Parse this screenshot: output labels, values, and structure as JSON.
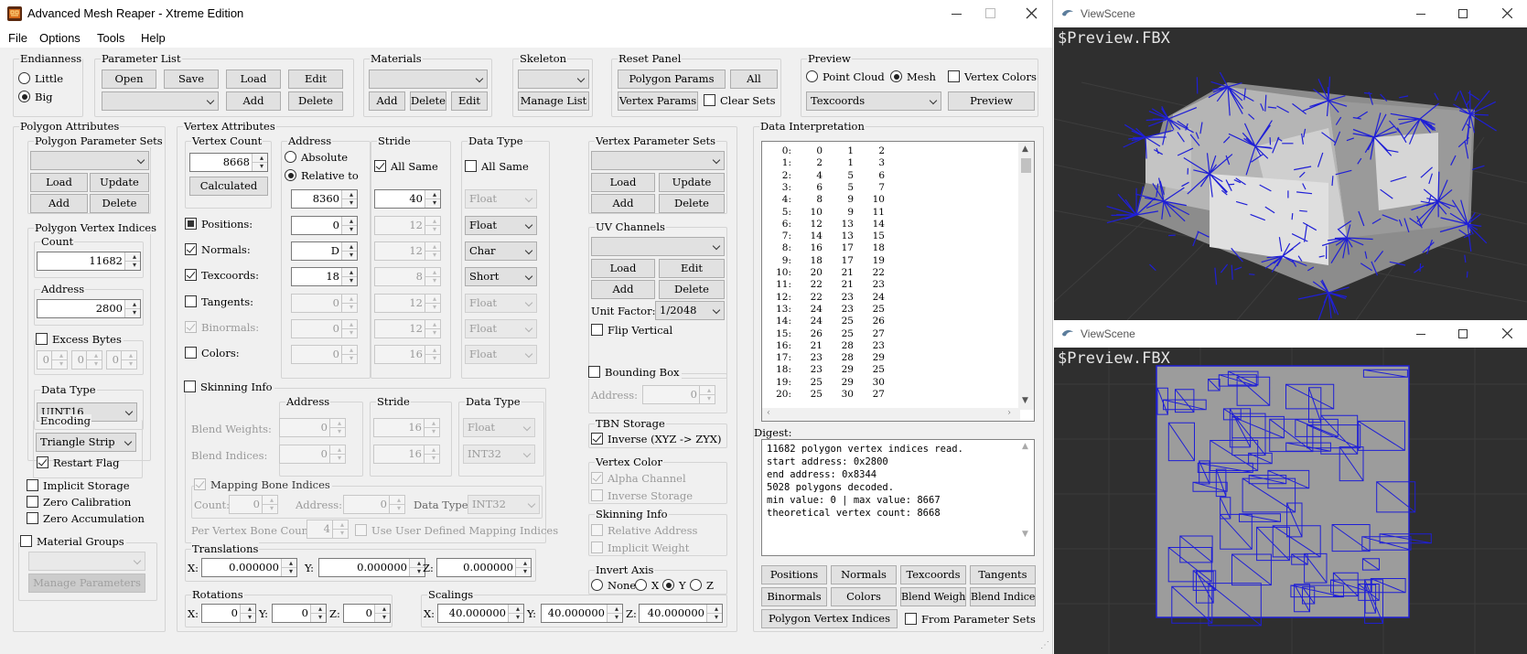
{
  "main_window": {
    "title": "Advanced Mesh Reaper - Xtreme Edition",
    "menu": [
      "File",
      "Options",
      "Tools",
      "Help"
    ]
  },
  "endianness": {
    "title": "Endianness",
    "little": "Little",
    "big": "Big",
    "selected": "Big"
  },
  "parameter_list": {
    "title": "Parameter List",
    "open": "Open",
    "save": "Save",
    "load": "Load",
    "edit": "Edit",
    "add": "Add",
    "delete": "Delete",
    "combo_value": ""
  },
  "materials": {
    "title": "Materials",
    "add": "Add",
    "delete": "Delete",
    "edit": "Edit",
    "combo_value": ""
  },
  "skeleton": {
    "title": "Skeleton",
    "manage_list": "Manage List",
    "combo_value": ""
  },
  "reset_panel": {
    "title": "Reset Panel",
    "polygon_params": "Polygon Params",
    "all": "All",
    "vertex_params": "Vertex Params",
    "clear_sets": "Clear Sets"
  },
  "preview": {
    "title": "Preview",
    "point_cloud": "Point Cloud",
    "mesh": "Mesh",
    "vertex_colors": "Vertex Colors",
    "texcoords": "Texcoords",
    "preview_button": "Preview",
    "selected": "Mesh"
  },
  "polygon_attributes": {
    "title": "Polygon Attributes",
    "param_sets": {
      "title": "Polygon Parameter Sets",
      "load": "Load",
      "update": "Update",
      "add": "Add",
      "delete": "Delete"
    },
    "vertex_indices": {
      "title": "Polygon Vertex Indices",
      "count_label": "Count",
      "count": "11682",
      "address_label": "Address",
      "address": "2800"
    },
    "excess_bytes": {
      "label": "Excess Bytes",
      "v1": "0",
      "v2": "0",
      "v3": "0"
    },
    "data_type": {
      "label": "Data Type",
      "value": "UINT16"
    },
    "encoding": {
      "label": "Encoding",
      "value": "Triangle Strip",
      "restart_flag": "Restart Flag"
    },
    "implicit_storage": "Implicit Storage",
    "zero_calibration": "Zero Calibration",
    "zero_accumulation": "Zero Accumulation",
    "material_groups": "Material Groups",
    "manage_parameters": "Manage Parameters"
  },
  "vertex_attributes": {
    "title": "Vertex Attributes",
    "vertex_count": {
      "title": "Vertex Count",
      "value": "8668",
      "calculated": "Calculated"
    },
    "address": {
      "title": "Address",
      "absolute": "Absolute",
      "relative_to": "Relative to",
      "base": "8360"
    },
    "stride": {
      "title": "Stride",
      "all_same": "All Same",
      "value": "40"
    },
    "data_type": {
      "title": "Data Type",
      "all_same": "All Same",
      "all_value": "Float"
    },
    "rows": [
      {
        "label": "Positions:",
        "address": "0",
        "stride": "12",
        "type": "Float"
      },
      {
        "label": "Normals:",
        "address": "D",
        "stride": "12",
        "type": "Char"
      },
      {
        "label": "Texcoords:",
        "address": "18",
        "stride": "8",
        "type": "Short"
      },
      {
        "label": "Tangents:",
        "address": "0",
        "stride": "12",
        "type": "Float"
      },
      {
        "label": "Binormals:",
        "address": "0",
        "stride": "12",
        "type": "Float"
      },
      {
        "label": "Colors:",
        "address": "0",
        "stride": "16",
        "type": "Float"
      }
    ],
    "skinning": {
      "title": "Skinning Info",
      "address_title": "Address",
      "stride_title": "Stride",
      "type_title": "Data Type",
      "blend_weights": "Blend Weights:",
      "bw_address": "0",
      "bw_stride": "16",
      "bw_type": "Float",
      "blend_indices": "Blend Indices:",
      "bi_address": "0",
      "bi_stride": "16",
      "bi_type": "INT32",
      "mapping": "Mapping Bone Indices",
      "count_label": "Count:",
      "count": "0",
      "addr_label": "Address:",
      "addr": "0",
      "type_label": "Data Type:",
      "type": "INT32",
      "per_vertex": "Per Vertex Bone Count:",
      "per_vertex_value": "4",
      "user_defined": "Use User Defined Mapping Indices"
    },
    "translations": {
      "title": "Translations",
      "x": "0.000000",
      "y": "0.000000",
      "z": "0.000000"
    },
    "rotations": {
      "title": "Rotations",
      "x": "0",
      "y": "0",
      "z": "0"
    },
    "scalings": {
      "title": "Scalings",
      "x": "40.000000",
      "y": "40.000000",
      "z": "40.000000"
    },
    "axis": {
      "x": "X:",
      "y": "Y:",
      "z": "Z:"
    }
  },
  "vertex_param_sets": {
    "title": "Vertex Parameter Sets",
    "load": "Load",
    "update": "Update",
    "add": "Add",
    "delete": "Delete"
  },
  "uv_channels": {
    "title": "UV Channels",
    "load": "Load",
    "edit": "Edit",
    "add": "Add",
    "delete": "Delete",
    "unit_factor_label": "Unit Factor:",
    "unit_factor": "1/2048",
    "flip_vertical": "Flip Vertical",
    "bounding_box": "Bounding Box",
    "address_label": "Address:",
    "address": "0"
  },
  "tbn_storage": {
    "title": "TBN Storage",
    "inverse": "Inverse (XYZ -> ZYX)"
  },
  "vertex_color": {
    "title": "Vertex Color",
    "alpha": "Alpha Channel",
    "inverse": "Inverse Storage"
  },
  "skinning_info_right": {
    "title": "Skinning Info",
    "relative": "Relative Address",
    "implicit": "Implicit Weight"
  },
  "invert_axis": {
    "title": "Invert Axis",
    "none": "None",
    "x": "X",
    "y": "Y",
    "z": "Z",
    "selected": "Y"
  },
  "data_interpretation": {
    "title": "Data Interpretation",
    "rows": [
      [
        "0:",
        "0",
        "1",
        "2"
      ],
      [
        "1:",
        "2",
        "1",
        "3"
      ],
      [
        "2:",
        "4",
        "5",
        "6"
      ],
      [
        "3:",
        "6",
        "5",
        "7"
      ],
      [
        "4:",
        "8",
        "9",
        "10"
      ],
      [
        "5:",
        "10",
        "9",
        "11"
      ],
      [
        "6:",
        "12",
        "13",
        "14"
      ],
      [
        "7:",
        "14",
        "13",
        "15"
      ],
      [
        "8:",
        "16",
        "17",
        "18"
      ],
      [
        "9:",
        "18",
        "17",
        "19"
      ],
      [
        "10:",
        "20",
        "21",
        "22"
      ],
      [
        "11:",
        "22",
        "21",
        "23"
      ],
      [
        "12:",
        "22",
        "23",
        "24"
      ],
      [
        "13:",
        "24",
        "23",
        "25"
      ],
      [
        "14:",
        "24",
        "25",
        "26"
      ],
      [
        "15:",
        "26",
        "25",
        "27"
      ],
      [
        "16:",
        "21",
        "28",
        "23"
      ],
      [
        "17:",
        "23",
        "28",
        "29"
      ],
      [
        "18:",
        "23",
        "29",
        "25"
      ],
      [
        "19:",
        "25",
        "29",
        "30"
      ],
      [
        "20:",
        "25",
        "30",
        "27"
      ]
    ],
    "digest_label": "Digest:",
    "digest": [
      "11682 polygon vertex indices read.",
      "start address: 0x2800",
      "end address: 0x8344",
      "5028 polygons decoded.",
      "min value: 0 | max value: 8667",
      "theoretical vertex count: 8668"
    ],
    "buttons": [
      "Positions",
      "Normals",
      "Texcoords",
      "Tangents",
      "Binormals",
      "Colors",
      "Blend Weights",
      "Blend Indices",
      "Polygon Vertex Indices"
    ],
    "from_param_sets": "From Parameter Sets"
  },
  "viewscene_top": {
    "title": "ViewScene",
    "label": "$Preview.FBX"
  },
  "viewscene_bottom": {
    "title": "ViewScene",
    "label": "$Preview.FBX"
  },
  "colors": {
    "accent_blue": "#1f1fd6",
    "viewport_bg": "#2f2f2f",
    "window_bg": "#f0f0f0"
  }
}
